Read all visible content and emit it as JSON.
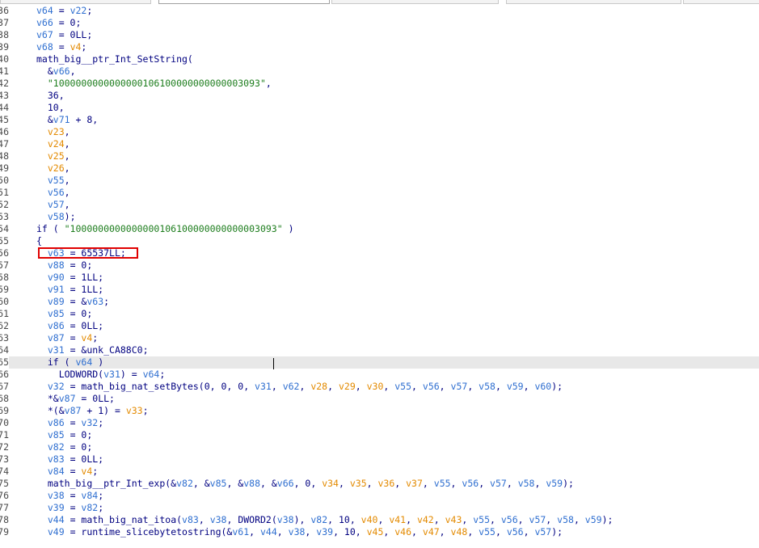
{
  "tabs": [
    {
      "label": ""
    },
    {
      "label": ""
    },
    {
      "label": ""
    },
    {
      "label": ""
    },
    {
      "label": ""
    }
  ],
  "colors": {
    "code": "#000080",
    "variable": "#2f6fd0",
    "argument": "#e38a00",
    "string": "#1d7d1d",
    "highlight_box": "#e00000",
    "current_line": "#e8e8e8"
  },
  "highlight": {
    "line_number": "56",
    "text": "v63 = 65537LL;"
  },
  "lines": [
    {
      "num": "36",
      "indent": "",
      "segs": [
        {
          "t": "v64",
          "c": "var"
        },
        {
          "t": " = "
        },
        {
          "t": "v22",
          "c": "var"
        },
        {
          "t": ";"
        }
      ]
    },
    {
      "num": "37",
      "indent": "",
      "segs": [
        {
          "t": "v66",
          "c": "var"
        },
        {
          "t": " = 0;"
        }
      ]
    },
    {
      "num": "38",
      "indent": "",
      "segs": [
        {
          "t": "v67",
          "c": "var"
        },
        {
          "t": " = 0LL;"
        }
      ]
    },
    {
      "num": "39",
      "indent": "",
      "segs": [
        {
          "t": "v68",
          "c": "var"
        },
        {
          "t": " = "
        },
        {
          "t": "v4",
          "c": "arg"
        },
        {
          "t": ";"
        }
      ]
    },
    {
      "num": "40",
      "indent": "",
      "segs": [
        {
          "t": "math_big__ptr_Int_SetString("
        }
      ]
    },
    {
      "num": "41",
      "indent": "  ",
      "segs": [
        {
          "t": "&"
        },
        {
          "t": "v66",
          "c": "var"
        },
        {
          "t": ","
        }
      ]
    },
    {
      "num": "42",
      "indent": "  ",
      "segs": [
        {
          "t": "\"1000000000000000106100000000000003093\"",
          "c": "str"
        },
        {
          "t": ","
        }
      ]
    },
    {
      "num": "43",
      "indent": "  ",
      "segs": [
        {
          "t": "36,"
        }
      ]
    },
    {
      "num": "44",
      "indent": "  ",
      "segs": [
        {
          "t": "10,"
        }
      ]
    },
    {
      "num": "45",
      "indent": "  ",
      "segs": [
        {
          "t": "&"
        },
        {
          "t": "v71",
          "c": "var"
        },
        {
          "t": " + 8,"
        }
      ]
    },
    {
      "num": "46",
      "indent": "  ",
      "segs": [
        {
          "t": "v23",
          "c": "arg"
        },
        {
          "t": ","
        }
      ]
    },
    {
      "num": "47",
      "indent": "  ",
      "segs": [
        {
          "t": "v24",
          "c": "arg"
        },
        {
          "t": ","
        }
      ]
    },
    {
      "num": "48",
      "indent": "  ",
      "segs": [
        {
          "t": "v25",
          "c": "arg"
        },
        {
          "t": ","
        }
      ]
    },
    {
      "num": "49",
      "indent": "  ",
      "segs": [
        {
          "t": "v26",
          "c": "arg"
        },
        {
          "t": ","
        }
      ]
    },
    {
      "num": "50",
      "indent": "  ",
      "segs": [
        {
          "t": "v55",
          "c": "var"
        },
        {
          "t": ","
        }
      ]
    },
    {
      "num": "51",
      "indent": "  ",
      "segs": [
        {
          "t": "v56",
          "c": "var"
        },
        {
          "t": ","
        }
      ]
    },
    {
      "num": "52",
      "indent": "  ",
      "segs": [
        {
          "t": "v57",
          "c": "var"
        },
        {
          "t": ","
        }
      ]
    },
    {
      "num": "53",
      "indent": "  ",
      "segs": [
        {
          "t": "v58",
          "c": "var"
        },
        {
          "t": ");"
        }
      ]
    },
    {
      "num": "54",
      "indent": "",
      "segs": [
        {
          "t": "if ( "
        },
        {
          "t": "\"1000000000000000106100000000000003093\"",
          "c": "str"
        },
        {
          "t": " )"
        }
      ]
    },
    {
      "num": "55",
      "indent": "",
      "segs": [
        {
          "t": "{"
        }
      ]
    },
    {
      "num": "56",
      "indent": "  ",
      "segs": [
        {
          "t": "v63",
          "c": "var"
        },
        {
          "t": " = 65537LL;"
        }
      ]
    },
    {
      "num": "57",
      "indent": "  ",
      "segs": [
        {
          "t": "v88",
          "c": "var"
        },
        {
          "t": " = 0;"
        }
      ]
    },
    {
      "num": "58",
      "indent": "  ",
      "segs": [
        {
          "t": "v90",
          "c": "var"
        },
        {
          "t": " = 1LL;"
        }
      ]
    },
    {
      "num": "59",
      "indent": "  ",
      "segs": [
        {
          "t": "v91",
          "c": "var"
        },
        {
          "t": " = 1LL;"
        }
      ]
    },
    {
      "num": "60",
      "indent": "  ",
      "segs": [
        {
          "t": "v89",
          "c": "var"
        },
        {
          "t": " = &"
        },
        {
          "t": "v63",
          "c": "var"
        },
        {
          "t": ";"
        }
      ]
    },
    {
      "num": "61",
      "indent": "  ",
      "segs": [
        {
          "t": "v85",
          "c": "var"
        },
        {
          "t": " = 0;"
        }
      ]
    },
    {
      "num": "62",
      "indent": "  ",
      "segs": [
        {
          "t": "v86",
          "c": "var"
        },
        {
          "t": " = 0LL;"
        }
      ]
    },
    {
      "num": "63",
      "indent": "  ",
      "segs": [
        {
          "t": "v87",
          "c": "var"
        },
        {
          "t": " = "
        },
        {
          "t": "v4",
          "c": "arg"
        },
        {
          "t": ";"
        }
      ]
    },
    {
      "num": "64",
      "indent": "  ",
      "segs": [
        {
          "t": "v31",
          "c": "var"
        },
        {
          "t": " = &unk_CA88C0;"
        }
      ]
    },
    {
      "num": "65",
      "indent": "  ",
      "current": true,
      "segs": [
        {
          "t": "if ( "
        },
        {
          "t": "v64",
          "c": "var"
        },
        {
          "t": " )"
        }
      ]
    },
    {
      "num": "66",
      "indent": "    ",
      "segs": [
        {
          "t": "LODWORD("
        },
        {
          "t": "v31",
          "c": "var"
        },
        {
          "t": ") = "
        },
        {
          "t": "v64",
          "c": "var"
        },
        {
          "t": ";"
        }
      ]
    },
    {
      "num": "67",
      "indent": "  ",
      "segs": [
        {
          "t": "v32",
          "c": "var"
        },
        {
          "t": " = math_big_nat_setBytes(0, 0, 0, "
        },
        {
          "t": "v31",
          "c": "var"
        },
        {
          "t": ", "
        },
        {
          "t": "v62",
          "c": "var"
        },
        {
          "t": ", "
        },
        {
          "t": "v28",
          "c": "arg"
        },
        {
          "t": ", "
        },
        {
          "t": "v29",
          "c": "arg"
        },
        {
          "t": ", "
        },
        {
          "t": "v30",
          "c": "arg"
        },
        {
          "t": ", "
        },
        {
          "t": "v55",
          "c": "var"
        },
        {
          "t": ", "
        },
        {
          "t": "v56",
          "c": "var"
        },
        {
          "t": ", "
        },
        {
          "t": "v57",
          "c": "var"
        },
        {
          "t": ", "
        },
        {
          "t": "v58",
          "c": "var"
        },
        {
          "t": ", "
        },
        {
          "t": "v59",
          "c": "var"
        },
        {
          "t": ", "
        },
        {
          "t": "v60",
          "c": "var"
        },
        {
          "t": ");"
        }
      ]
    },
    {
      "num": "68",
      "indent": "  ",
      "segs": [
        {
          "t": "*&"
        },
        {
          "t": "v87",
          "c": "var"
        },
        {
          "t": " = 0LL;"
        }
      ]
    },
    {
      "num": "69",
      "indent": "  ",
      "segs": [
        {
          "t": "*(&"
        },
        {
          "t": "v87",
          "c": "var"
        },
        {
          "t": " + 1) = "
        },
        {
          "t": "v33",
          "c": "arg"
        },
        {
          "t": ";"
        }
      ]
    },
    {
      "num": "70",
      "indent": "  ",
      "segs": [
        {
          "t": "v86",
          "c": "var"
        },
        {
          "t": " = "
        },
        {
          "t": "v32",
          "c": "var"
        },
        {
          "t": ";"
        }
      ]
    },
    {
      "num": "71",
      "indent": "  ",
      "segs": [
        {
          "t": "v85",
          "c": "var"
        },
        {
          "t": " = 0;"
        }
      ]
    },
    {
      "num": "72",
      "indent": "  ",
      "segs": [
        {
          "t": "v82",
          "c": "var"
        },
        {
          "t": " = 0;"
        }
      ]
    },
    {
      "num": "73",
      "indent": "  ",
      "segs": [
        {
          "t": "v83",
          "c": "var"
        },
        {
          "t": " = 0LL;"
        }
      ]
    },
    {
      "num": "74",
      "indent": "  ",
      "segs": [
        {
          "t": "v84",
          "c": "var"
        },
        {
          "t": " = "
        },
        {
          "t": "v4",
          "c": "arg"
        },
        {
          "t": ";"
        }
      ]
    },
    {
      "num": "75",
      "indent": "  ",
      "segs": [
        {
          "t": "math_big__ptr_Int_exp(&"
        },
        {
          "t": "v82",
          "c": "var"
        },
        {
          "t": ", &"
        },
        {
          "t": "v85",
          "c": "var"
        },
        {
          "t": ", &"
        },
        {
          "t": "v88",
          "c": "var"
        },
        {
          "t": ", &"
        },
        {
          "t": "v66",
          "c": "var"
        },
        {
          "t": ", 0, "
        },
        {
          "t": "v34",
          "c": "arg"
        },
        {
          "t": ", "
        },
        {
          "t": "v35",
          "c": "arg"
        },
        {
          "t": ", "
        },
        {
          "t": "v36",
          "c": "arg"
        },
        {
          "t": ", "
        },
        {
          "t": "v37",
          "c": "arg"
        },
        {
          "t": ", "
        },
        {
          "t": "v55",
          "c": "var"
        },
        {
          "t": ", "
        },
        {
          "t": "v56",
          "c": "var"
        },
        {
          "t": ", "
        },
        {
          "t": "v57",
          "c": "var"
        },
        {
          "t": ", "
        },
        {
          "t": "v58",
          "c": "var"
        },
        {
          "t": ", "
        },
        {
          "t": "v59",
          "c": "var"
        },
        {
          "t": ");"
        }
      ]
    },
    {
      "num": "76",
      "indent": "  ",
      "segs": [
        {
          "t": "v38",
          "c": "var"
        },
        {
          "t": " = "
        },
        {
          "t": "v84",
          "c": "var"
        },
        {
          "t": ";"
        }
      ]
    },
    {
      "num": "77",
      "indent": "  ",
      "segs": [
        {
          "t": "v39",
          "c": "var"
        },
        {
          "t": " = "
        },
        {
          "t": "v82",
          "c": "var"
        },
        {
          "t": ";"
        }
      ]
    },
    {
      "num": "78",
      "indent": "  ",
      "segs": [
        {
          "t": "v44",
          "c": "var"
        },
        {
          "t": " = math_big_nat_itoa("
        },
        {
          "t": "v83",
          "c": "var"
        },
        {
          "t": ", "
        },
        {
          "t": "v38",
          "c": "var"
        },
        {
          "t": ", DWORD2("
        },
        {
          "t": "v38",
          "c": "var"
        },
        {
          "t": "), "
        },
        {
          "t": "v82",
          "c": "var"
        },
        {
          "t": ", 10, "
        },
        {
          "t": "v40",
          "c": "arg"
        },
        {
          "t": ", "
        },
        {
          "t": "v41",
          "c": "arg"
        },
        {
          "t": ", "
        },
        {
          "t": "v42",
          "c": "arg"
        },
        {
          "t": ", "
        },
        {
          "t": "v43",
          "c": "arg"
        },
        {
          "t": ", "
        },
        {
          "t": "v55",
          "c": "var"
        },
        {
          "t": ", "
        },
        {
          "t": "v56",
          "c": "var"
        },
        {
          "t": ", "
        },
        {
          "t": "v57",
          "c": "var"
        },
        {
          "t": ", "
        },
        {
          "t": "v58",
          "c": "var"
        },
        {
          "t": ", "
        },
        {
          "t": "v59",
          "c": "var"
        },
        {
          "t": ");"
        }
      ]
    },
    {
      "num": "79",
      "indent": "  ",
      "segs": [
        {
          "t": "v49",
          "c": "var"
        },
        {
          "t": " = runtime_slicebytetostring(&"
        },
        {
          "t": "v61",
          "c": "var"
        },
        {
          "t": ", "
        },
        {
          "t": "v44",
          "c": "var"
        },
        {
          "t": ", "
        },
        {
          "t": "v38",
          "c": "var"
        },
        {
          "t": ", "
        },
        {
          "t": "v39",
          "c": "var"
        },
        {
          "t": ", 10, "
        },
        {
          "t": "v45",
          "c": "arg"
        },
        {
          "t": ", "
        },
        {
          "t": "v46",
          "c": "arg"
        },
        {
          "t": ", "
        },
        {
          "t": "v47",
          "c": "arg"
        },
        {
          "t": ", "
        },
        {
          "t": "v48",
          "c": "arg"
        },
        {
          "t": ", "
        },
        {
          "t": "v55",
          "c": "var"
        },
        {
          "t": ", "
        },
        {
          "t": "v56",
          "c": "var"
        },
        {
          "t": ", "
        },
        {
          "t": "v57",
          "c": "var"
        },
        {
          "t": ");"
        }
      ]
    }
  ]
}
